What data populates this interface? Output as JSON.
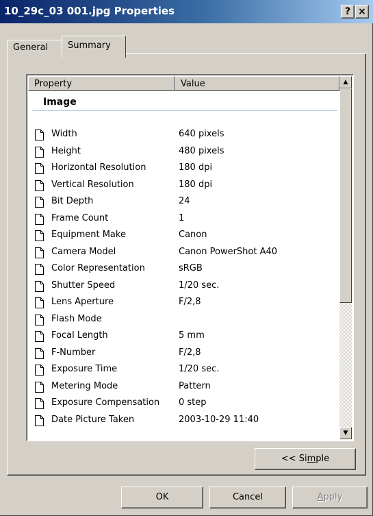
{
  "window": {
    "title": "10_29c_03 001.jpg Properties",
    "help_label": "?",
    "close_label": "×"
  },
  "tabs": [
    {
      "label": "General",
      "active": false
    },
    {
      "label": "Summary",
      "active": true
    }
  ],
  "list": {
    "columns": {
      "property": "Property",
      "value": "Value"
    },
    "group": "Image",
    "rows": [
      {
        "property": "Width",
        "value": "640 pixels"
      },
      {
        "property": "Height",
        "value": "480 pixels"
      },
      {
        "property": "Horizontal Resolution",
        "value": "180 dpi"
      },
      {
        "property": "Vertical Resolution",
        "value": "180 dpi"
      },
      {
        "property": "Bit Depth",
        "value": "24"
      },
      {
        "property": "Frame Count",
        "value": "1"
      },
      {
        "property": "Equipment Make",
        "value": "Canon"
      },
      {
        "property": "Camera Model",
        "value": "Canon PowerShot A40"
      },
      {
        "property": "Color Representation",
        "value": "sRGB"
      },
      {
        "property": "Shutter Speed",
        "value": "1/20 sec."
      },
      {
        "property": "Lens Aperture",
        "value": "F/2,8"
      },
      {
        "property": "Flash Mode",
        "value": ""
      },
      {
        "property": "Focal Length",
        "value": "5 mm"
      },
      {
        "property": "F-Number",
        "value": "F/2,8"
      },
      {
        "property": "Exposure Time",
        "value": "1/20 sec."
      },
      {
        "property": "Metering Mode",
        "value": "Pattern"
      },
      {
        "property": "Exposure Compensation",
        "value": "0 step"
      },
      {
        "property": "Date Picture Taken",
        "value": "2003-10-29 11:40"
      }
    ]
  },
  "buttons": {
    "simple": {
      "pre": "<< Si",
      "u": "m",
      "post": "ple"
    },
    "ok": "OK",
    "cancel": "Cancel",
    "apply": {
      "u": "A",
      "post": "pply"
    }
  },
  "colors": {
    "titlebar_start": "#0a246a",
    "titlebar_end": "#a6caf0",
    "face": "#d4d0c8"
  }
}
